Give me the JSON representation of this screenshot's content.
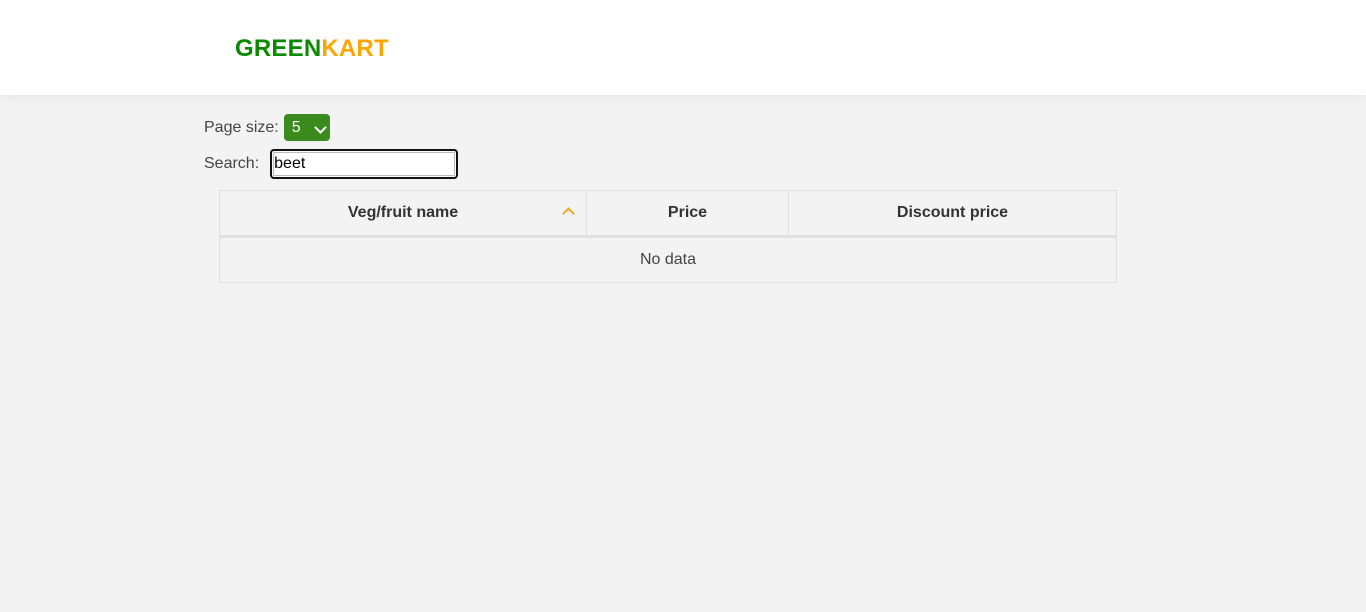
{
  "header": {
    "brand_part1": "GREEN",
    "brand_part2": "KART"
  },
  "controls": {
    "page_size_label": "Page size:",
    "page_size_value": "5",
    "search_label": "Search:",
    "search_value": "beet"
  },
  "table": {
    "columns": [
      "Veg/fruit name",
      "Price",
      "Discount price"
    ],
    "sorted_column": "Veg/fruit name",
    "sort_direction": "ascending",
    "empty_message": "No data"
  },
  "colors": {
    "brand_green": "#0b8a00",
    "brand_orange": "#ffa500",
    "select_background": "#3a8a1e",
    "sort_indicator": "#f5a623"
  }
}
